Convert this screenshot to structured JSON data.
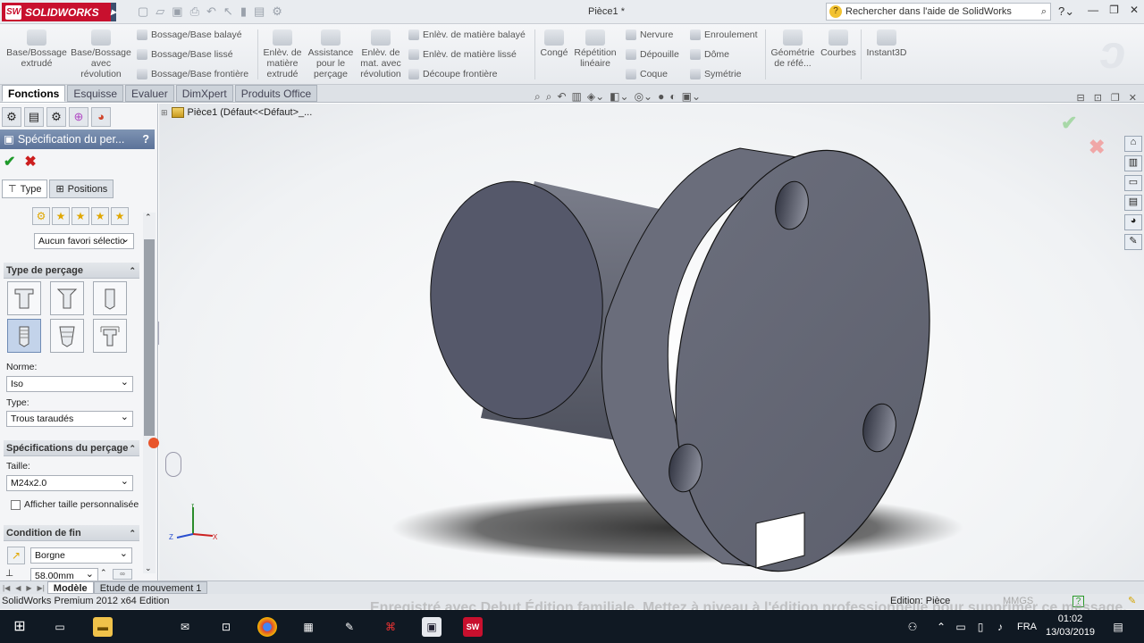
{
  "app": {
    "logo": "SOLIDWORKS",
    "logo_mark": "SW",
    "doc_title": "Pièce1 *"
  },
  "search": {
    "placeholder": "Rechercher dans l'aide de SolidWorks"
  },
  "ribbon": {
    "base_extrude": "Base/Bossage extrudé",
    "base_revolve": "Base/Bossage avec révolution",
    "swept_boss": "Bossage/Base balayé",
    "loft_boss": "Bossage/Base lissé",
    "boundary_boss": "Bossage/Base frontière",
    "extruded_cut": "Enlèv. de matière extrudé",
    "hole_wizard": "Assistance pour le perçage",
    "revolved_cut": "Enlèv. de mat. avec révolution",
    "swept_cut": "Enlèv. de matière balayé",
    "loft_cut": "Enlèv. de matière lissé",
    "boundary_cut": "Découpe frontière",
    "fillet": "Congé",
    "linear_pattern": "Répétition linéaire",
    "rib": "Nervure",
    "draft": "Dépouille",
    "shell": "Coque",
    "wrap": "Enroulement",
    "dome": "Dôme",
    "mirror": "Symétrie",
    "ref_geometry": "Géométrie de réfé...",
    "curves": "Courbes",
    "instant3d": "Instant3D"
  },
  "tabs": [
    "Fonctions",
    "Esquisse",
    "Evaluer",
    "DimXpert",
    "Produits Office"
  ],
  "tree": {
    "root": "Pièce1  (Défaut<<Défaut>_..."
  },
  "property_manager": {
    "title": "Spécification du per...",
    "help": "?",
    "ok": "✔",
    "cancel": "✖",
    "tab_type": "Type",
    "tab_positions": "Positions",
    "favorite": "Aucun favori sélectio",
    "hole_type_header": "Type de perçage",
    "standard_label": "Norme:",
    "standard_value": "Iso",
    "type_label": "Type:",
    "type_value": "Trous taraudés",
    "spec_header": "Spécifications du perçage",
    "size_label": "Taille:",
    "size_value": "M24x2.0",
    "custom_size": "Afficher taille personnalisée",
    "end_header": "Condition de fin",
    "end_value": "Borgne",
    "depth_value": "58.00mm"
  },
  "bottom_tabs": [
    "Modèle",
    "Etude de mouvement 1"
  ],
  "status": {
    "edition": "SolidWorks Premium 2012 x64 Edition",
    "editing": "Edition: Pièce",
    "units": "MMGS",
    "help": "?",
    "watermark": "Enregistré avec Debut Édition familiale. Mettez à niveau à l'édition professionnelle pour supprimer ce message."
  },
  "taskbar": {
    "lang": "FRA",
    "time": "01:02",
    "date": "13/03/2019"
  }
}
